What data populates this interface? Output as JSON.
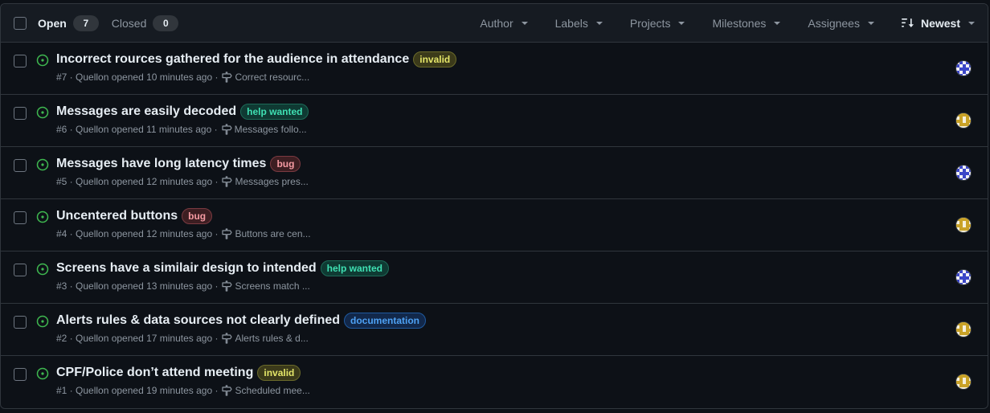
{
  "header": {
    "open_label": "Open",
    "open_count": "7",
    "closed_label": "Closed",
    "closed_count": "0",
    "filters": [
      "Author",
      "Labels",
      "Projects",
      "Milestones",
      "Assignees"
    ],
    "sort_label": "Newest"
  },
  "issues": [
    {
      "title": "Incorrect rources gathered for the audience in attendance",
      "label": "invalid",
      "meta": "#7 · Quellon opened 10 minutes ago ·",
      "milestone": "Correct resourc..."
    },
    {
      "title": "Messages are easily decoded",
      "label": "help wanted",
      "meta": "#6 · Quellon opened 11 minutes ago ·",
      "milestone": "Messages follo..."
    },
    {
      "title": "Messages have long latency times",
      "label": "bug",
      "meta": "#5 · Quellon opened 12 minutes ago ·",
      "milestone": "Messages pres..."
    },
    {
      "title": "Uncentered buttons",
      "label": "bug",
      "meta": "#4 · Quellon opened 12 minutes ago ·",
      "milestone": "Buttons are cen..."
    },
    {
      "title": "Screens have a similair design to intended",
      "label": "help wanted",
      "meta": "#3 · Quellon opened 13 minutes ago ·",
      "milestone": "Screens match ..."
    },
    {
      "title": "Alerts rules & data sources not clearly defined",
      "label": "documentation",
      "meta": "#2 · Quellon opened 17 minutes ago ·",
      "milestone": "Alerts rules & d..."
    },
    {
      "title": "CPF/Police don’t attend meeting",
      "label": "invalid",
      "meta": "#1 · Quellon opened 19 minutes ago ·",
      "milestone": "Scheduled mee..."
    }
  ],
  "colors": {
    "open_icon": "#3fb950",
    "avatar_blue": "#3b46c8",
    "avatar_gold": "#c9a227"
  },
  "icons": {
    "open": "issue-opened-icon",
    "milestone": "milestone-icon",
    "sort": "sort-desc-icon"
  }
}
